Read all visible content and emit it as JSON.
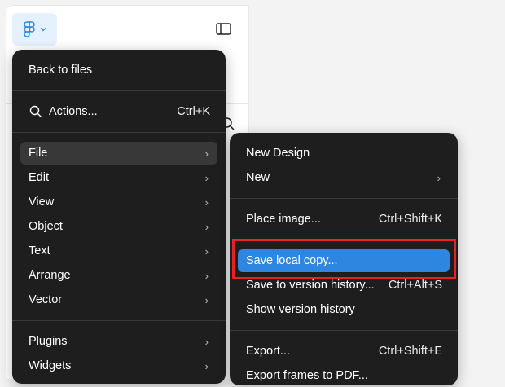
{
  "main_menu": {
    "back": "Back to files",
    "actions": {
      "label": "Actions...",
      "shortcut": "Ctrl+K"
    },
    "items": [
      {
        "label": "File",
        "chevron": "›"
      },
      {
        "label": "Edit",
        "chevron": "›"
      },
      {
        "label": "View",
        "chevron": "›"
      },
      {
        "label": "Object",
        "chevron": "›"
      },
      {
        "label": "Text",
        "chevron": "›"
      },
      {
        "label": "Arrange",
        "chevron": "›"
      },
      {
        "label": "Vector",
        "chevron": "›"
      }
    ],
    "items2": [
      {
        "label": "Plugins",
        "chevron": "›"
      },
      {
        "label": "Widgets",
        "chevron": "›"
      }
    ]
  },
  "file_menu": {
    "new_design": "New Design",
    "new": {
      "label": "New",
      "chevron": "›"
    },
    "place_image": {
      "label": "Place image...",
      "shortcut": "Ctrl+Shift+K"
    },
    "save_local": "Save local copy...",
    "save_version": {
      "label": "Save to version history...",
      "shortcut": "Ctrl+Alt+S"
    },
    "show_version": "Show version history",
    "export": {
      "label": "Export...",
      "shortcut": "Ctrl+Shift+E"
    },
    "export_frames": "Export frames to PDF..."
  },
  "colors": {
    "menu_bg": "#1e1e1e",
    "accent": "#2f86e0",
    "highlight": "#e32324",
    "logo_bg": "#e5f1fd"
  },
  "icons": {
    "logo": "figma-logo-icon",
    "logo_caret": "chevron-down-icon",
    "sidebar": "sidebar-toggle-icon",
    "search": "search-icon"
  }
}
